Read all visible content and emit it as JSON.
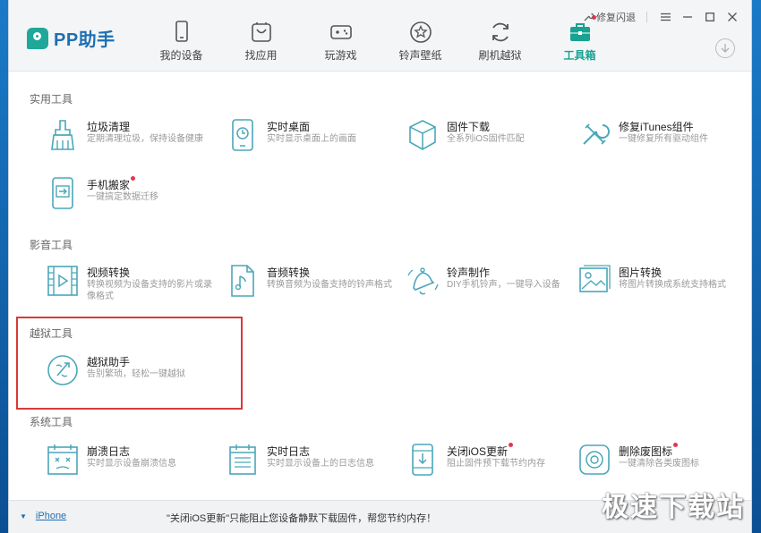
{
  "app": {
    "name": "PP助手"
  },
  "titlebar": {
    "repair_label": "修复闪退"
  },
  "nav": [
    {
      "label": "我的设备",
      "icon": "device-icon",
      "active": false
    },
    {
      "label": "找应用",
      "icon": "app-store-icon",
      "active": false
    },
    {
      "label": "玩游戏",
      "icon": "gamepad-icon",
      "active": false
    },
    {
      "label": "铃声壁纸",
      "icon": "star-icon",
      "active": false
    },
    {
      "label": "刷机越狱",
      "icon": "refresh-icon",
      "active": false
    },
    {
      "label": "工具箱",
      "icon": "toolbox-icon",
      "active": true
    }
  ],
  "sections": [
    {
      "title": "实用工具",
      "items": [
        {
          "name": "垃圾清理",
          "desc": "定期清理垃圾，保持设备健康",
          "icon": "broom-icon"
        },
        {
          "name": "实时桌面",
          "desc": "实时显示桌面上的画面",
          "icon": "desktop-clock-icon"
        },
        {
          "name": "固件下载",
          "desc": "全系列iOS固件匹配",
          "icon": "cube-icon"
        },
        {
          "name": "修复iTunes组件",
          "desc": "一键修复所有驱动组件",
          "icon": "wrench-icon"
        },
        {
          "name": "手机搬家",
          "desc": "一键搞定数据迁移",
          "icon": "phone-transfer-icon"
        }
      ]
    },
    {
      "title": "影音工具",
      "items": [
        {
          "name": "视频转换",
          "desc": "转换视频为设备支持的影片或录像格式",
          "icon": "video-icon"
        },
        {
          "name": "音频转换",
          "desc": "转换音频为设备支持的铃声格式",
          "icon": "audio-file-icon"
        },
        {
          "name": "铃声制作",
          "desc": "DIY手机铃声，一键导入设备",
          "icon": "bell-icon"
        },
        {
          "name": "图片转换",
          "desc": "将图片转换成系统支持格式",
          "icon": "image-icon"
        }
      ]
    },
    {
      "title": "越狱工具",
      "items": [
        {
          "name": "越狱助手",
          "desc": "告别繁琐，轻松一键越狱",
          "icon": "jailbreak-icon"
        }
      ]
    },
    {
      "title": "系统工具",
      "items": [
        {
          "name": "崩溃日志",
          "desc": "实时显示设备崩溃信息",
          "icon": "crash-log-icon"
        },
        {
          "name": "实时日志",
          "desc": "实时显示设备上的日志信息",
          "icon": "log-icon"
        },
        {
          "name": "关闭iOS更新",
          "desc": "阻止固件预下载节约内存",
          "icon": "phone-block-icon"
        },
        {
          "name": "删除废图标",
          "desc": "一键清除各类废图标",
          "icon": "delete-icon-icon"
        }
      ]
    }
  ],
  "footer": {
    "device": "iPhone",
    "message": "\"关闭iOS更新\"只能阻止您设备静默下载固件，帮您节约内存！"
  },
  "watermark": "极速下载站",
  "colors": {
    "accent": "#18a292",
    "brand": "#1e6fb3",
    "highlight": "#d83a3a",
    "badge": "#e8344f"
  }
}
